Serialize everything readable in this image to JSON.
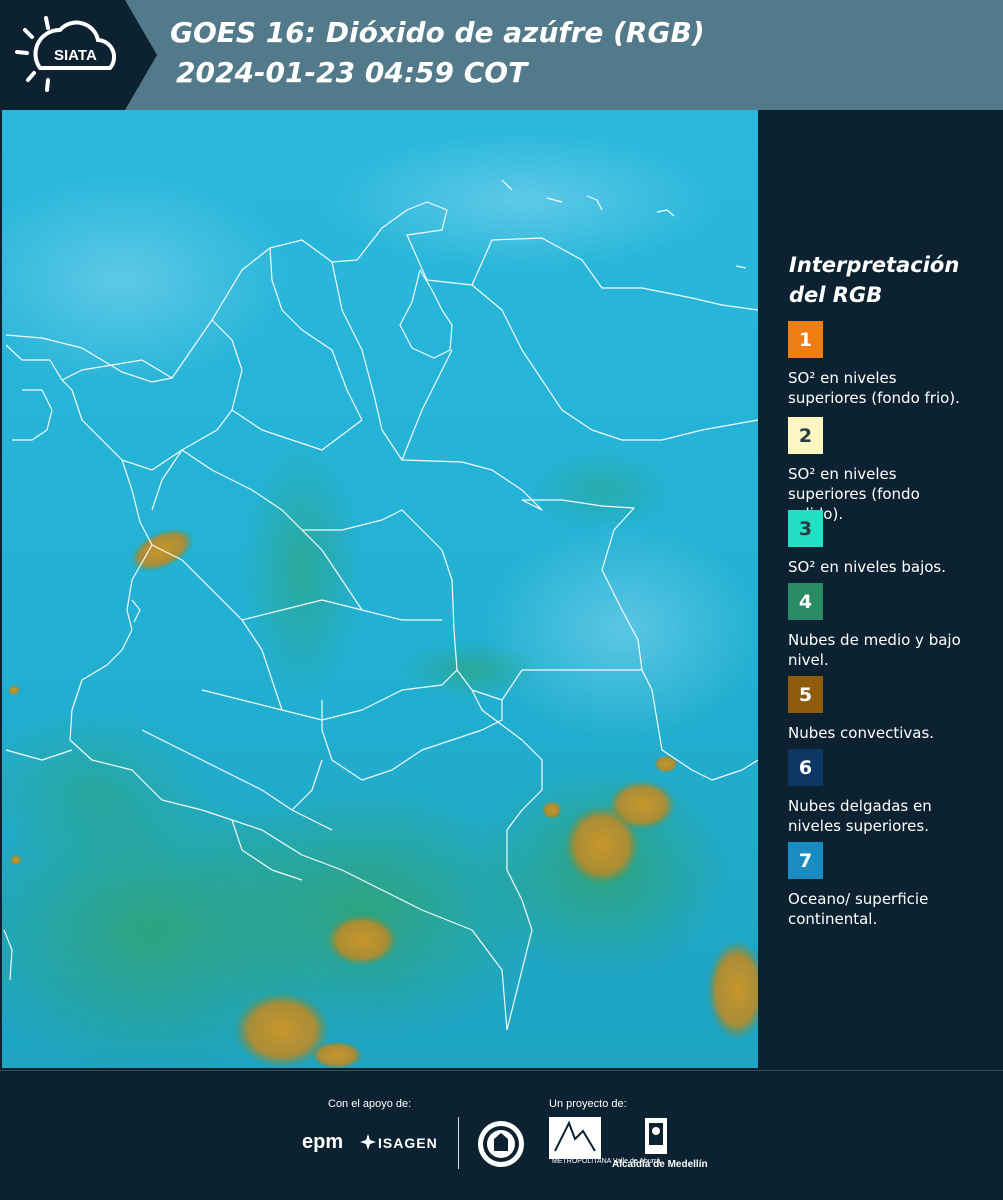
{
  "header": {
    "logo_text": "SIATA",
    "title": "GOES 16: Dióxido de azúfre (RGB)",
    "subtitle": "2024-01-23 04:59 COT",
    "bg_color": "#537a8a",
    "logo_bg_color": "#0c2231"
  },
  "legend": {
    "title": "Interpretación del RGB",
    "items": [
      {
        "number": "1",
        "color": "#f07d12",
        "text": "SO² en niveles superiores (fondo frio)."
      },
      {
        "number": "2",
        "color": "#fdf6c3",
        "text": "SO² en niveles superiores (fondo calido)."
      },
      {
        "number": "3",
        "color": "#22e0c4",
        "text": "SO² en niveles bajos."
      },
      {
        "number": "4",
        "color": "#2a8a64",
        "text": "Nubes de medio y bajo nivel."
      },
      {
        "number": "5",
        "color": "#8e5c0c",
        "text": "Nubes convectivas."
      },
      {
        "number": "6",
        "color": "#0f3766",
        "text": "Nubes delgadas en niveles superiores."
      },
      {
        "number": "7",
        "color": "#1a8cc0",
        "text": "Oceano/ superficie continental."
      }
    ]
  },
  "footer": {
    "support_label": "Con el apoyo de:",
    "project_label": "Un proyecto de:",
    "sponsors": [
      "epm",
      "ISAGEN"
    ],
    "area_label": "METROPOLITANA Valle de Aburrá",
    "alcaldia_label": "Alcaldía de Medellín"
  },
  "map": {
    "ocean_color": "#24b3d8",
    "border_color": "#ffffff"
  }
}
